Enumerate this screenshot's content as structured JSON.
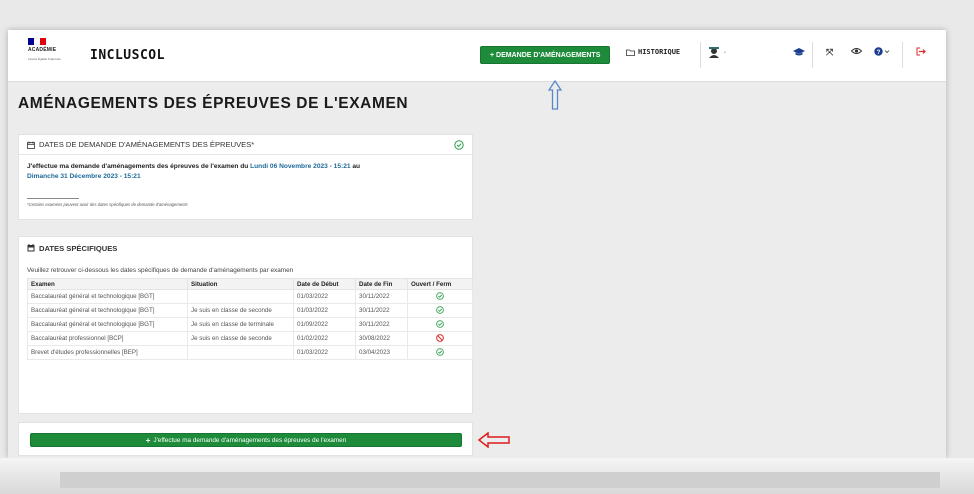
{
  "header": {
    "logo": {
      "line1": "ACADÉMIE",
      "line2": "Liberté Égalité Fraternité",
      "flag_colors": [
        "#000091",
        "#ffffff",
        "#e1000f"
      ]
    },
    "brand": "INCLUSCOL",
    "demande_button": "+ DEMANDE D'AMÉNAGEMENTS",
    "historique_button": "HISTORIQUE",
    "icons": [
      "student-icon",
      "graduation-cap-icon",
      "expand-icon",
      "eye-icon",
      "help-icon",
      "logout-icon"
    ]
  },
  "page_title": "AMÉNAGEMENTS DES ÉPREUVES DE L'EXAMEN",
  "dates_card": {
    "title": "DATES DE DEMANDE D'AMÉNAGEMENTS DES ÉPREUVES*",
    "text_prefix": "J'effectue ma demande d'aménagements des épreuves de l'examen du ",
    "start_date": "Lundi 06 Novembre 2023 - 15:21",
    "text_middle": " au",
    "end_date": "Dimanche 31 Décembre 2023 - 15:21",
    "note": "*Certains examens peuvent avoir des dates spécifiques de demande d'aménagements"
  },
  "specific_card": {
    "title": "DATES SPÉCIFIQUES",
    "intro": "Veuillez retrouver ci-dessous les dates spécifiques de demande d'aménagements par examen",
    "columns": [
      "Examen",
      "Situation",
      "Date de Début",
      "Date de Fin",
      "Ouvert / Ferm"
    ],
    "rows": [
      {
        "examen": "Baccalauréat général et technologique [BGT]",
        "situation": "",
        "debut": "01/03/2022",
        "fin": "30/11/2022",
        "status": "open"
      },
      {
        "examen": "Baccalauréat général et technologique [BGT]",
        "situation": "Je suis en classe de seconde",
        "debut": "01/03/2022",
        "fin": "30/11/2022",
        "status": "open"
      },
      {
        "examen": "Baccalauréat général et technologique [BGT]",
        "situation": "Je suis en classe de terminale",
        "debut": "01/09/2022",
        "fin": "30/11/2022",
        "status": "open"
      },
      {
        "examen": "Baccalauréat professionnel [BCP]",
        "situation": "Je suis en classe de seconde",
        "debut": "01/02/2022",
        "fin": "30/08/2022",
        "status": "closed"
      },
      {
        "examen": "Brevet d'études professionnelles [BEP]",
        "situation": "",
        "debut": "01/03/2022",
        "fin": "03/04/2023",
        "status": "open"
      }
    ]
  },
  "main_button": "J'effectue ma demande d'aménagements des épreuves de l'examen",
  "colors": {
    "primary_green": "#1e8b3b",
    "link_blue": "#1d6a9a",
    "ok_green": "#2e9e4e",
    "closed_red": "#e02b2b",
    "annotation_blue": "#5b86c7",
    "annotation_red": "#e01b1b"
  }
}
